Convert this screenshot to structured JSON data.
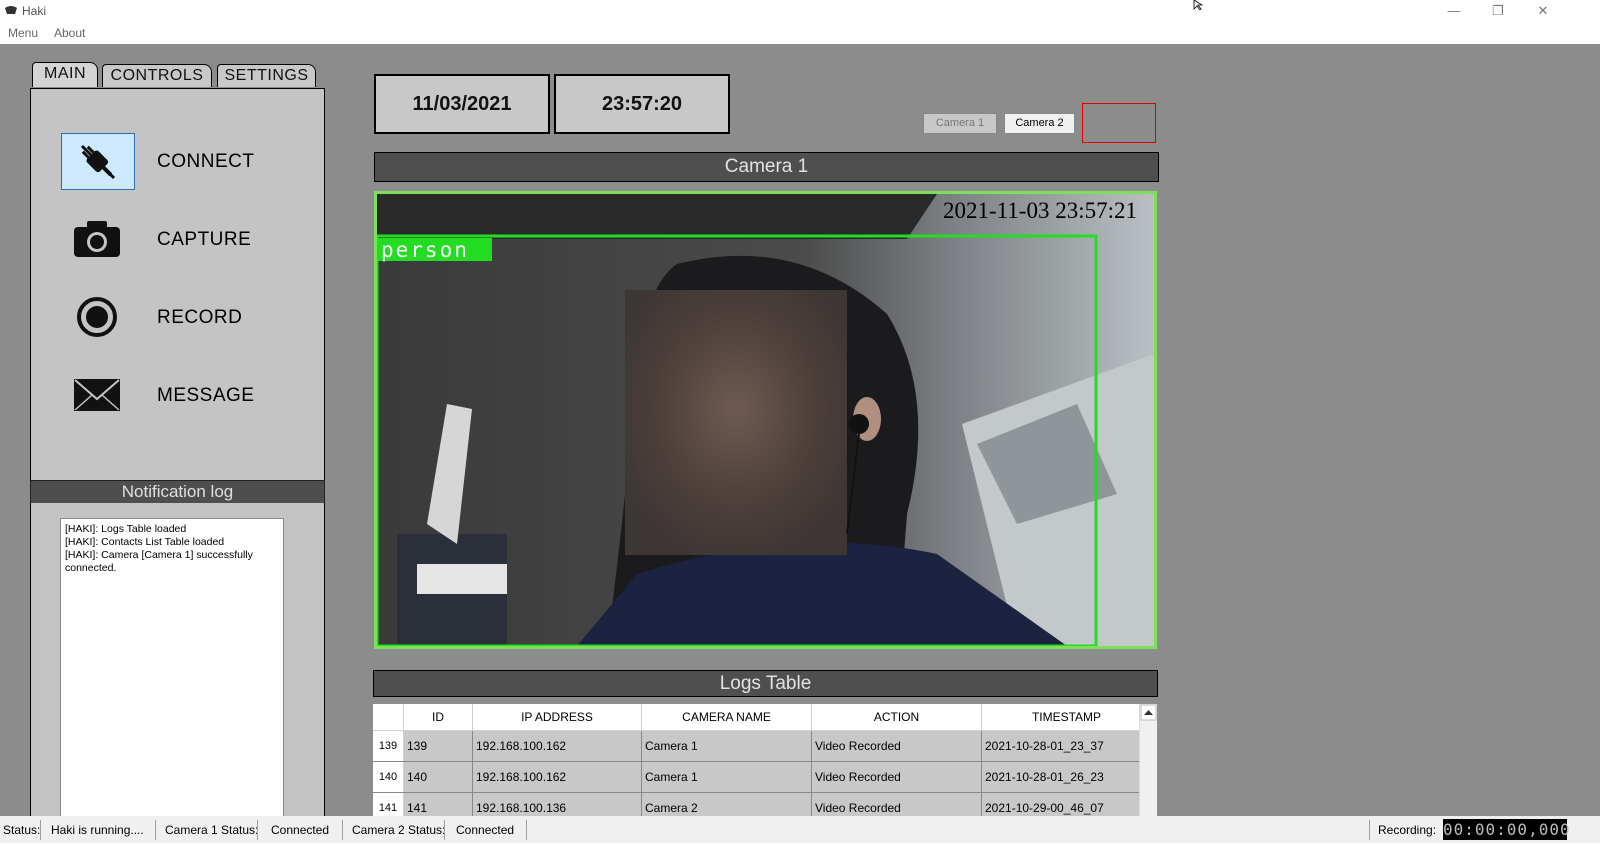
{
  "window": {
    "title": "Haki",
    "minimize_glyph": "—",
    "restore_glyph": "❐",
    "close_glyph": "✕"
  },
  "menu": {
    "items": [
      "Menu",
      "About"
    ]
  },
  "tabs": [
    "MAIN",
    "CONTROLS",
    "SETTINGS"
  ],
  "actions": [
    {
      "label": "CONNECT",
      "icon": "plug-disconnect-icon"
    },
    {
      "label": "CAPTURE",
      "icon": "camera-icon"
    },
    {
      "label": "RECORD",
      "icon": "record-icon"
    },
    {
      "label": "MESSAGE",
      "icon": "envelope-icon"
    }
  ],
  "notification": {
    "title": "Notification log",
    "lines": [
      "[HAKI]: Logs Table loaded",
      "[HAKI]: Contacts List Table loaded",
      "[HAKI]: Camera [Camera 1] successfully connected."
    ]
  },
  "date": "11/03/2021",
  "time": "23:57:20",
  "camera_buttons": [
    "Camera 1",
    "Camera 2"
  ],
  "camera_view": {
    "title": "Camera 1",
    "timestamp": "2021-11-03 23:57:21",
    "detection_label": "person",
    "colors": {
      "frame": "#7ce05a",
      "detection": "#22dd22"
    }
  },
  "logs": {
    "title": "Logs Table",
    "columns": [
      "ID",
      "IP ADDRESS",
      "CAMERA NAME",
      "ACTION",
      "TIMESTAMP"
    ],
    "rows": [
      {
        "row": "139",
        "id": "139",
        "ip": "192.168.100.162",
        "camera": "Camera 1",
        "action": "Video Recorded",
        "timestamp": "2021-10-28-01_23_37"
      },
      {
        "row": "140",
        "id": "140",
        "ip": "192.168.100.162",
        "camera": "Camera 1",
        "action": "Video Recorded",
        "timestamp": "2021-10-28-01_26_23"
      },
      {
        "row": "141",
        "id": "141",
        "ip": "192.168.100.136",
        "camera": "Camera 2",
        "action": "Video Recorded",
        "timestamp": "2021-10-29-00_46_07"
      }
    ]
  },
  "status": {
    "label": "Status:",
    "value": "Haki is running....",
    "cam1_label": "Camera 1 Status:",
    "cam1_value": "Connected",
    "cam2_label": "Camera 2 Status:",
    "cam2_value": "Connected",
    "recording_label": "Recording:",
    "recording_value": "00:00:00,000"
  }
}
